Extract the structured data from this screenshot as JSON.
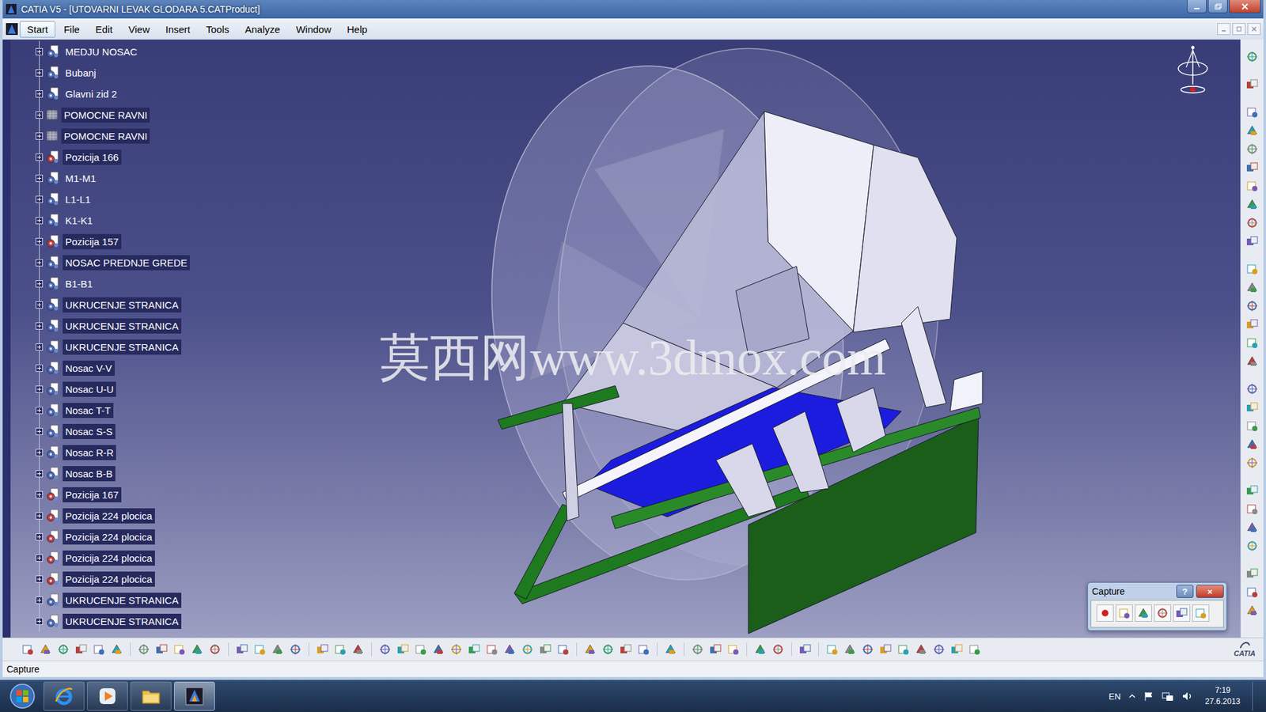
{
  "window": {
    "title": "CATIA V5 - [UTOVARNI LEVAK GLODARA 5.CATProduct]"
  },
  "menu": [
    {
      "label": "Start",
      "selected": true
    },
    {
      "label": "File",
      "selected": false
    },
    {
      "label": "Edit",
      "selected": false
    },
    {
      "label": "View",
      "selected": false
    },
    {
      "label": "Insert",
      "selected": false
    },
    {
      "label": "Tools",
      "selected": false
    },
    {
      "label": "Analyze",
      "selected": false
    },
    {
      "label": "Window",
      "selected": false
    },
    {
      "label": "Help",
      "selected": false
    }
  ],
  "tree": {
    "items": [
      {
        "label": "MEDJU NOSAC",
        "kind": "product",
        "selected": false
      },
      {
        "label": "Bubanj",
        "kind": "product",
        "selected": false
      },
      {
        "label": "Glavni zid 2",
        "kind": "product",
        "selected": false
      },
      {
        "label": "POMOCNE RAVNI",
        "kind": "plane",
        "selected": true
      },
      {
        "label": "POMOCNE RAVNI",
        "kind": "plane",
        "selected": true
      },
      {
        "label": "Pozicija 166",
        "kind": "part",
        "selected": true
      },
      {
        "label": "M1-M1",
        "kind": "product",
        "selected": false
      },
      {
        "label": "L1-L1",
        "kind": "product",
        "selected": false
      },
      {
        "label": "K1-K1",
        "kind": "product",
        "selected": false
      },
      {
        "label": "Pozicija 157",
        "kind": "part",
        "selected": true
      },
      {
        "label": "NOSAC PREDNJE GREDE",
        "kind": "product",
        "selected": true
      },
      {
        "label": "B1-B1",
        "kind": "product",
        "selected": false
      },
      {
        "label": "UKRUCENJE STRANICA",
        "kind": "product",
        "selected": true
      },
      {
        "label": "UKRUCENJE STRANICA",
        "kind": "product",
        "selected": true
      },
      {
        "label": "UKRUCENJE STRANICA",
        "kind": "product",
        "selected": true
      },
      {
        "label": "Nosac V-V",
        "kind": "product",
        "selected": true
      },
      {
        "label": "Nosac U-U",
        "kind": "product",
        "selected": true
      },
      {
        "label": "Nosac T-T",
        "kind": "product",
        "selected": true
      },
      {
        "label": "Nosac S-S",
        "kind": "product",
        "selected": true
      },
      {
        "label": "Nosac R-R",
        "kind": "product",
        "selected": true
      },
      {
        "label": "Nosac B-B",
        "kind": "product",
        "selected": true
      },
      {
        "label": "Pozicija 167",
        "kind": "part",
        "selected": true
      },
      {
        "label": "Pozicija 224 plocica",
        "kind": "part",
        "selected": true
      },
      {
        "label": "Pozicija 224 plocica",
        "kind": "part",
        "selected": true
      },
      {
        "label": "Pozicija 224 plocica",
        "kind": "part",
        "selected": true
      },
      {
        "label": "Pozicija 224 plocica",
        "kind": "part",
        "selected": true
      },
      {
        "label": "UKRUCENJE STRANICA",
        "kind": "product",
        "selected": true
      },
      {
        "label": "UKRUCENJE STRANICA",
        "kind": "product",
        "selected": true
      }
    ]
  },
  "watermark": "莫西网www.3dmox.com",
  "capture_dialog": {
    "title": "Capture",
    "help": "?",
    "close": "×"
  },
  "toolbar": {
    "logo": "CATIA"
  },
  "status_bar": "Capture",
  "taskbar": {
    "apps": [
      {
        "kind": "ie",
        "selected": false
      },
      {
        "kind": "media",
        "selected": false
      },
      {
        "kind": "explorer",
        "selected": false
      },
      {
        "kind": "catia",
        "selected": true
      }
    ],
    "language": "EN",
    "time": "7:19",
    "date": "27.6.2013"
  }
}
